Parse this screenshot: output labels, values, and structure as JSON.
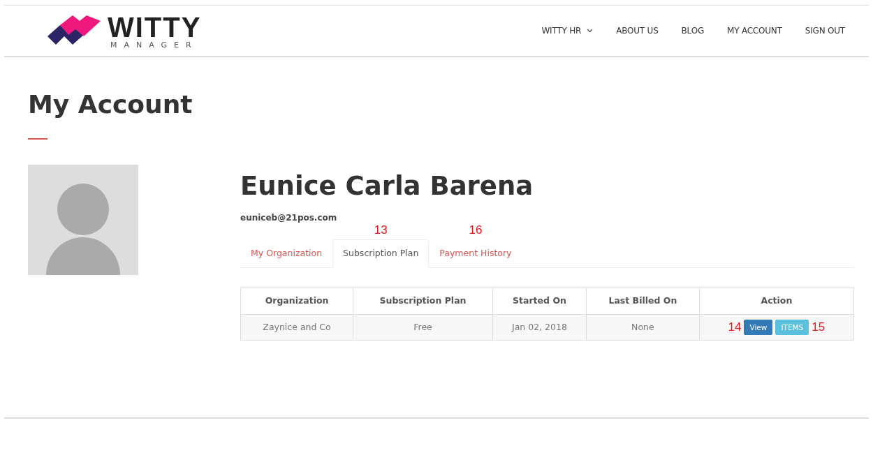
{
  "logo": {
    "word": "WITTY",
    "tagline": "MANAGER"
  },
  "nav": [
    {
      "label": "WITTY HR",
      "dropdown": true
    },
    {
      "label": "ABOUT US",
      "dropdown": false
    },
    {
      "label": "BLOG",
      "dropdown": false
    },
    {
      "label": "MY ACCOUNT",
      "dropdown": false
    },
    {
      "label": "SIGN OUT",
      "dropdown": false
    }
  ],
  "page_title": "My Account",
  "profile": {
    "name": "Eunice Carla Barena",
    "email": "euniceb@21pos.com"
  },
  "tabs": [
    {
      "label": "My Organization",
      "selected": false
    },
    {
      "label": "Subscription Plan",
      "selected": true,
      "marker": "13"
    },
    {
      "label": "Payment History",
      "selected": false,
      "marker": "16"
    }
  ],
  "table": {
    "columns": [
      "Organization",
      "Subscription Plan",
      "Started On",
      "Last Billed On",
      "Action"
    ],
    "rows": [
      {
        "cells": [
          "Zaynice and Co",
          "Free",
          "Jan 02, 2018",
          "None"
        ],
        "actions": [
          {
            "label": "View",
            "kind": "primary",
            "marker_before": "14"
          },
          {
            "label": "ITEMS",
            "kind": "info",
            "marker_after": "15"
          }
        ]
      }
    ]
  }
}
